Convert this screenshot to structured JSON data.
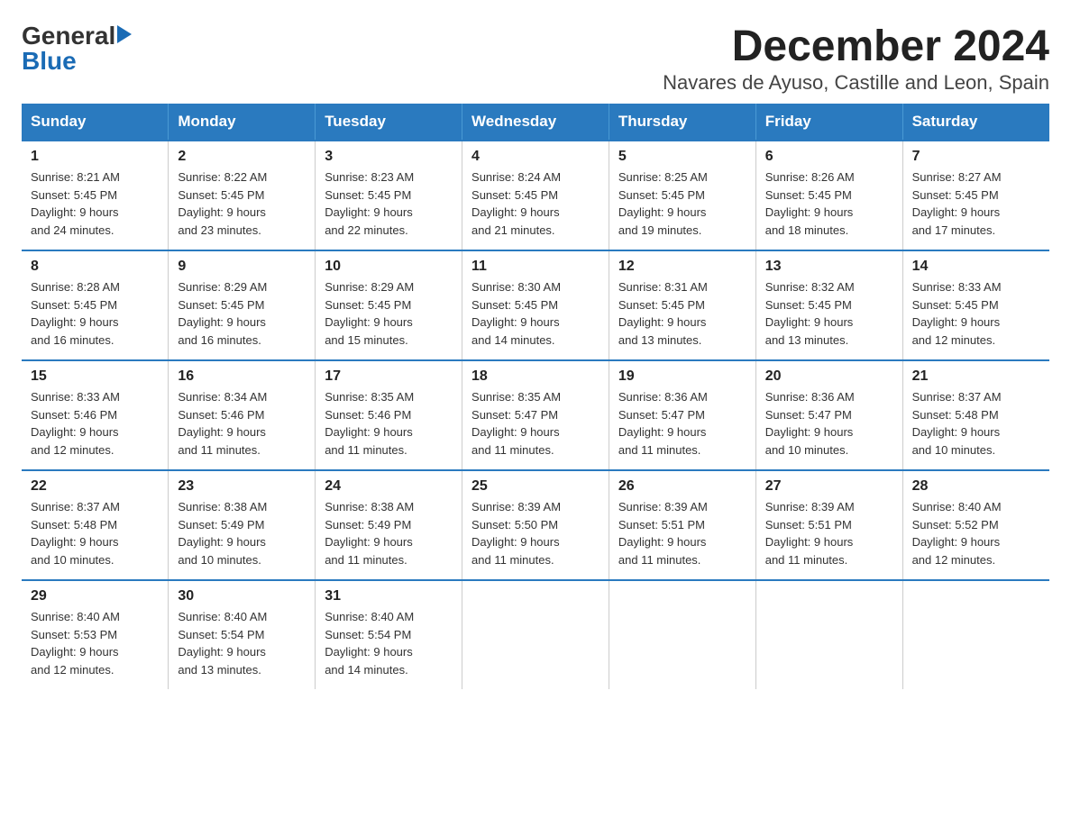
{
  "logo": {
    "general": "General",
    "blue": "Blue"
  },
  "header": {
    "month_year": "December 2024",
    "location": "Navares de Ayuso, Castille and Leon, Spain"
  },
  "weekdays": [
    "Sunday",
    "Monday",
    "Tuesday",
    "Wednesday",
    "Thursday",
    "Friday",
    "Saturday"
  ],
  "weeks": [
    [
      {
        "day": "1",
        "sunrise": "8:21 AM",
        "sunset": "5:45 PM",
        "daylight": "9 hours and 24 minutes."
      },
      {
        "day": "2",
        "sunrise": "8:22 AM",
        "sunset": "5:45 PM",
        "daylight": "9 hours and 23 minutes."
      },
      {
        "day": "3",
        "sunrise": "8:23 AM",
        "sunset": "5:45 PM",
        "daylight": "9 hours and 22 minutes."
      },
      {
        "day": "4",
        "sunrise": "8:24 AM",
        "sunset": "5:45 PM",
        "daylight": "9 hours and 21 minutes."
      },
      {
        "day": "5",
        "sunrise": "8:25 AM",
        "sunset": "5:45 PM",
        "daylight": "9 hours and 19 minutes."
      },
      {
        "day": "6",
        "sunrise": "8:26 AM",
        "sunset": "5:45 PM",
        "daylight": "9 hours and 18 minutes."
      },
      {
        "day": "7",
        "sunrise": "8:27 AM",
        "sunset": "5:45 PM",
        "daylight": "9 hours and 17 minutes."
      }
    ],
    [
      {
        "day": "8",
        "sunrise": "8:28 AM",
        "sunset": "5:45 PM",
        "daylight": "9 hours and 16 minutes."
      },
      {
        "day": "9",
        "sunrise": "8:29 AM",
        "sunset": "5:45 PM",
        "daylight": "9 hours and 16 minutes."
      },
      {
        "day": "10",
        "sunrise": "8:29 AM",
        "sunset": "5:45 PM",
        "daylight": "9 hours and 15 minutes."
      },
      {
        "day": "11",
        "sunrise": "8:30 AM",
        "sunset": "5:45 PM",
        "daylight": "9 hours and 14 minutes."
      },
      {
        "day": "12",
        "sunrise": "8:31 AM",
        "sunset": "5:45 PM",
        "daylight": "9 hours and 13 minutes."
      },
      {
        "day": "13",
        "sunrise": "8:32 AM",
        "sunset": "5:45 PM",
        "daylight": "9 hours and 13 minutes."
      },
      {
        "day": "14",
        "sunrise": "8:33 AM",
        "sunset": "5:45 PM",
        "daylight": "9 hours and 12 minutes."
      }
    ],
    [
      {
        "day": "15",
        "sunrise": "8:33 AM",
        "sunset": "5:46 PM",
        "daylight": "9 hours and 12 minutes."
      },
      {
        "day": "16",
        "sunrise": "8:34 AM",
        "sunset": "5:46 PM",
        "daylight": "9 hours and 11 minutes."
      },
      {
        "day": "17",
        "sunrise": "8:35 AM",
        "sunset": "5:46 PM",
        "daylight": "9 hours and 11 minutes."
      },
      {
        "day": "18",
        "sunrise": "8:35 AM",
        "sunset": "5:47 PM",
        "daylight": "9 hours and 11 minutes."
      },
      {
        "day": "19",
        "sunrise": "8:36 AM",
        "sunset": "5:47 PM",
        "daylight": "9 hours and 11 minutes."
      },
      {
        "day": "20",
        "sunrise": "8:36 AM",
        "sunset": "5:47 PM",
        "daylight": "9 hours and 10 minutes."
      },
      {
        "day": "21",
        "sunrise": "8:37 AM",
        "sunset": "5:48 PM",
        "daylight": "9 hours and 10 minutes."
      }
    ],
    [
      {
        "day": "22",
        "sunrise": "8:37 AM",
        "sunset": "5:48 PM",
        "daylight": "9 hours and 10 minutes."
      },
      {
        "day": "23",
        "sunrise": "8:38 AM",
        "sunset": "5:49 PM",
        "daylight": "9 hours and 10 minutes."
      },
      {
        "day": "24",
        "sunrise": "8:38 AM",
        "sunset": "5:49 PM",
        "daylight": "9 hours and 11 minutes."
      },
      {
        "day": "25",
        "sunrise": "8:39 AM",
        "sunset": "5:50 PM",
        "daylight": "9 hours and 11 minutes."
      },
      {
        "day": "26",
        "sunrise": "8:39 AM",
        "sunset": "5:51 PM",
        "daylight": "9 hours and 11 minutes."
      },
      {
        "day": "27",
        "sunrise": "8:39 AM",
        "sunset": "5:51 PM",
        "daylight": "9 hours and 11 minutes."
      },
      {
        "day": "28",
        "sunrise": "8:40 AM",
        "sunset": "5:52 PM",
        "daylight": "9 hours and 12 minutes."
      }
    ],
    [
      {
        "day": "29",
        "sunrise": "8:40 AM",
        "sunset": "5:53 PM",
        "daylight": "9 hours and 12 minutes."
      },
      {
        "day": "30",
        "sunrise": "8:40 AM",
        "sunset": "5:54 PM",
        "daylight": "9 hours and 13 minutes."
      },
      {
        "day": "31",
        "sunrise": "8:40 AM",
        "sunset": "5:54 PM",
        "daylight": "9 hours and 14 minutes."
      },
      null,
      null,
      null,
      null
    ]
  ],
  "labels": {
    "sunrise": "Sunrise:",
    "sunset": "Sunset:",
    "daylight": "Daylight:"
  }
}
